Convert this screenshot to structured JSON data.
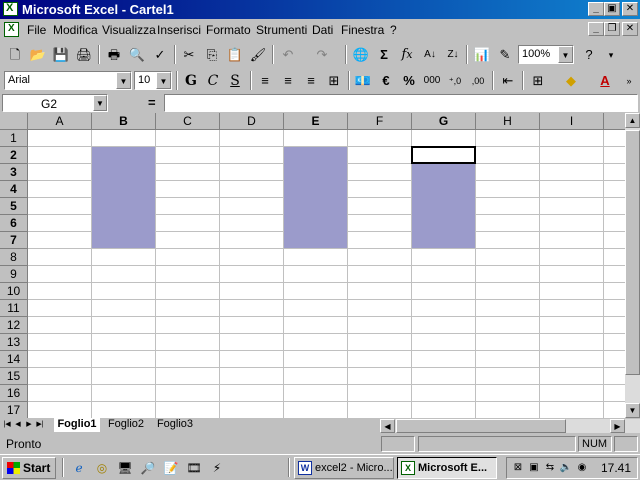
{
  "window": {
    "title": "Microsoft Excel - Cartel1"
  },
  "menu": [
    "File",
    "Modifica",
    "Visualizza",
    "Inserisci",
    "Formato",
    "Strumenti",
    "Dati",
    "Finestra",
    "?"
  ],
  "toolbar_standard": {
    "zoom": "100%"
  },
  "toolbar_format": {
    "font": "Arial",
    "size": "10",
    "bold": "G",
    "italic": "C",
    "underline": "S",
    "euro": "€",
    "percent": "%",
    "thousands": "000",
    "inc_decimal": "⁺,0",
    "dec_decimal": ",00"
  },
  "formula_bar": {
    "name_box": "G2",
    "equals": "=",
    "content": ""
  },
  "columns": [
    "A",
    "B",
    "C",
    "D",
    "E",
    "F",
    "G",
    "H",
    "I"
  ],
  "rows": [
    "1",
    "2",
    "3",
    "4",
    "5",
    "6",
    "7",
    "8",
    "9",
    "10",
    "11",
    "12",
    "13",
    "14",
    "15",
    "16",
    "17"
  ],
  "selection": {
    "active_cell": "G2",
    "selected_columns": [
      "B",
      "E",
      "G"
    ],
    "selected_rows": [
      "2",
      "3",
      "4",
      "5",
      "6",
      "7"
    ]
  },
  "sheets": [
    "Foglio1",
    "Foglio2",
    "Foglio3"
  ],
  "active_sheet": "Foglio1",
  "status": {
    "text": "Pronto",
    "num": "NUM"
  },
  "taskbar": {
    "start": "Start",
    "tasks": [
      {
        "label": "excel2 - Micro...",
        "active": false
      },
      {
        "label": "Microsoft E...",
        "active": true
      }
    ],
    "clock": "17.41"
  },
  "colors": {
    "title_gradient_start": "#000080",
    "title_gradient_end": "#1084d0",
    "selection_fill": "#9b9bcb",
    "window_face": "#c0c0c0"
  }
}
